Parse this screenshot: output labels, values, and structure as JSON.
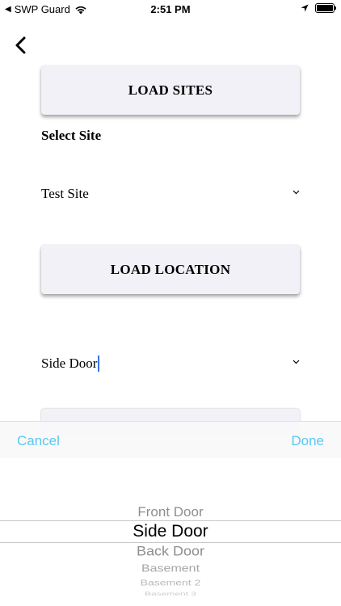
{
  "status_bar": {
    "back_app": "SWP Guard",
    "time": "2:51 PM"
  },
  "buttons": {
    "load_sites": "LOAD SITES",
    "load_location": "LOAD LOCATION"
  },
  "site_section": {
    "label": "Select Site",
    "selected": "Test Site"
  },
  "location_section": {
    "selected": "Side Door"
  },
  "picker": {
    "cancel": "Cancel",
    "done": "Done",
    "options": [
      "Front Door",
      "Side Door",
      "Back Door",
      "Basement",
      "Basement 2",
      "Basement 3"
    ],
    "selected": "Side Door"
  },
  "colors": {
    "toolbar_accent": "#5ac8f2",
    "button_bg": "#f2f1f7",
    "cursor": "#3a6ff0"
  },
  "icons": {
    "status_back": "back-triangle-icon",
    "wifi": "wifi-icon",
    "location": "location-arrow-icon",
    "battery": "battery-icon",
    "nav_back": "chevron-left-icon",
    "dropdown": "chevron-down-icon"
  }
}
